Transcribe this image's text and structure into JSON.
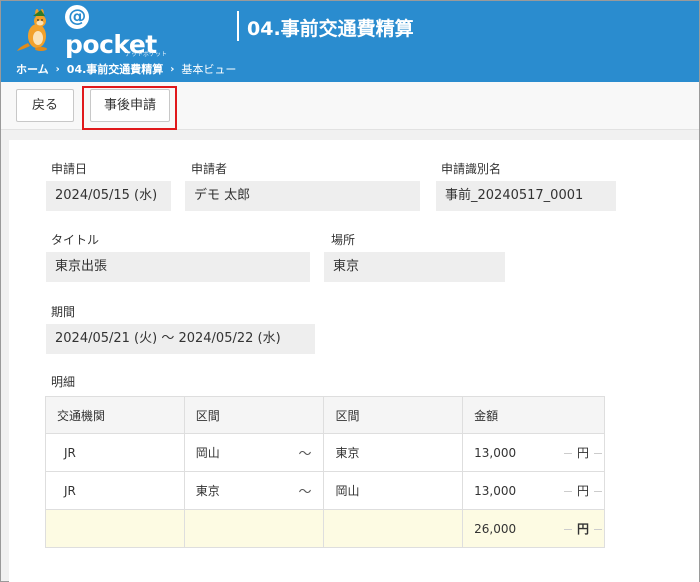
{
  "header": {
    "logo_text": "pocket",
    "logo_at": "@",
    "logo_sub": "アットポケット",
    "title": "04.事前交通費精算",
    "breadcrumb": [
      "ホーム",
      "04.事前交通費精算",
      "基本ビュー"
    ],
    "breadcrumb_sep": "›"
  },
  "toolbar": {
    "back_label": "戻る",
    "post_apply_label": "事後申請"
  },
  "form": {
    "apply_date": {
      "label": "申請日",
      "value": "2024/05/15 (水)"
    },
    "applicant": {
      "label": "申請者",
      "value": "デモ 太郎"
    },
    "apply_id": {
      "label": "申請識別名",
      "value": "事前_20240517_0001"
    },
    "title": {
      "label": "タイトル",
      "value": "東京出張"
    },
    "place": {
      "label": "場所",
      "value": "東京"
    },
    "period": {
      "label": "期間",
      "value": "2024/05/21 (火) 〜 2024/05/22 (水)"
    }
  },
  "details": {
    "label": "明細",
    "columns": [
      "交通機関",
      "区間",
      "区間",
      "金額"
    ],
    "rows": [
      {
        "transport": "JR",
        "from": "岡山",
        "tilde": "〜",
        "to": "東京",
        "amount": "13,000",
        "unit": "円"
      },
      {
        "transport": "JR",
        "from": "東京",
        "tilde": "〜",
        "to": "岡山",
        "amount": "13,000",
        "unit": "円"
      }
    ],
    "total": {
      "amount": "26,000",
      "unit": "円"
    }
  },
  "colors": {
    "header_bg": "#2a8ccf",
    "highlight": "#e0181b",
    "total_row_bg": "#fdfbe3"
  }
}
